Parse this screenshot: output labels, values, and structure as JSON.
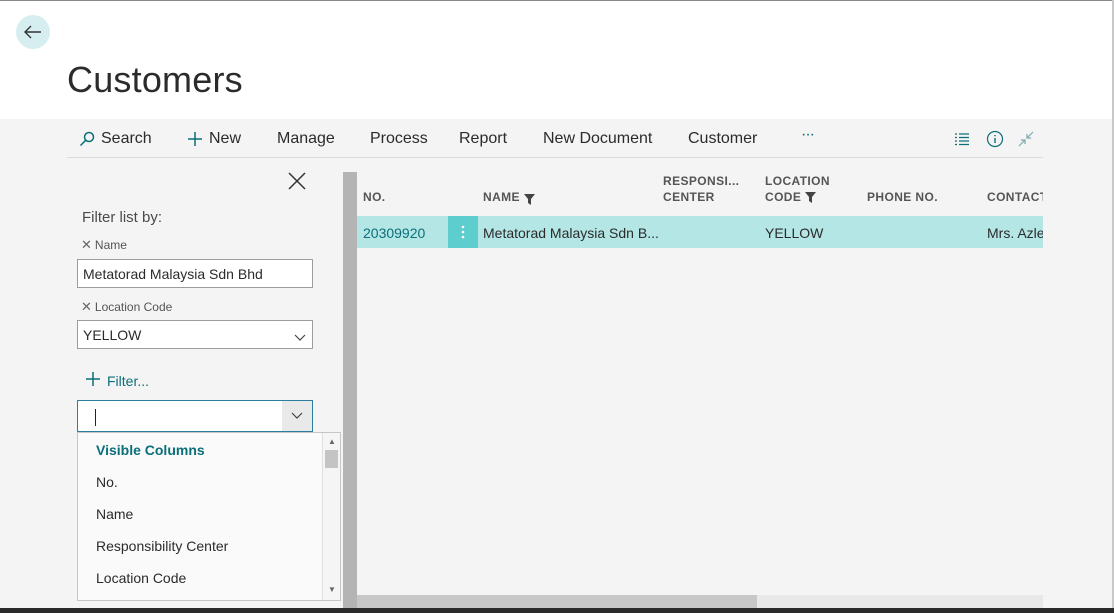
{
  "page": {
    "title": "Customers"
  },
  "actions": {
    "search": "Search",
    "new": "New",
    "manage": "Manage",
    "process": "Process",
    "report": "Report",
    "new_document": "New Document",
    "customer": "Customer",
    "more": "···"
  },
  "filter_pane": {
    "heading": "Filter list by:",
    "criteria": [
      {
        "label": "Name",
        "value": "Metatorad Malaysia Sdn Bhd"
      },
      {
        "label": "Location Code",
        "value": "YELLOW"
      }
    ],
    "add_filter": "Filter...",
    "field_input": ""
  },
  "dropdown": {
    "header": "Visible Columns",
    "items": [
      "No.",
      "Name",
      "Responsibility Center",
      "Location Code"
    ]
  },
  "grid": {
    "columns": {
      "no": "NO.",
      "name": "NAME",
      "resp_1": "RESPONSI...",
      "resp_2": "CENTER",
      "loc_1": "LOCATION",
      "loc_2": "CODE",
      "phone": "PHONE NO.",
      "contact": "CONTACT"
    },
    "rows": [
      {
        "no": "20309920",
        "name": "Metatorad Malaysia Sdn B...",
        "responsibility_center": "",
        "location_code": "YELLOW",
        "phone": "",
        "contact": "Mrs. Azle"
      }
    ]
  },
  "colors": {
    "accent": "#0a6f79",
    "selected_row": "#b4e6e6",
    "row_menu": "#5ecdcd",
    "back_button": "#d6eef0"
  }
}
